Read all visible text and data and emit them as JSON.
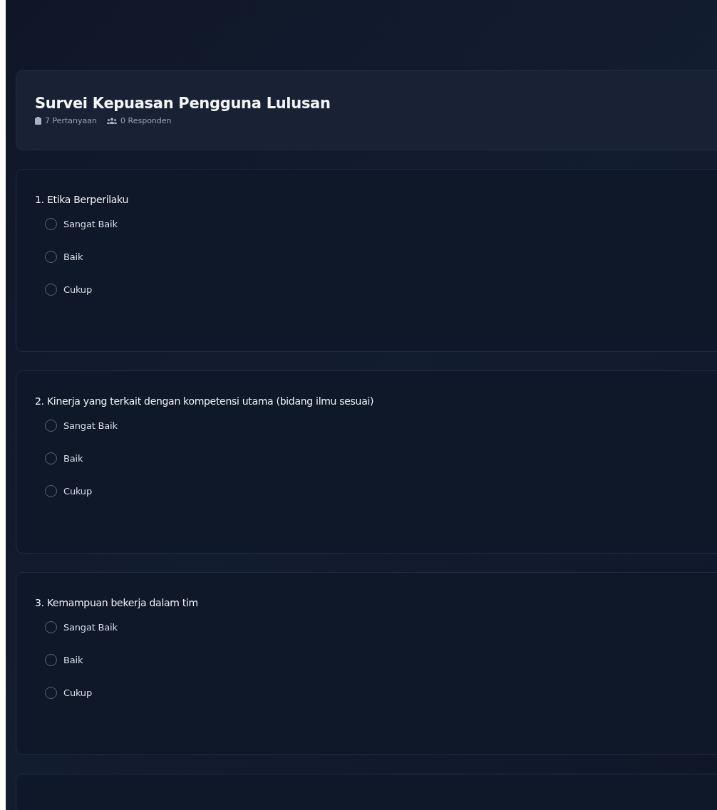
{
  "survey": {
    "title": "Survei Kepuasan Pengguna Lulusan",
    "questions_count": "7 Pertanyaan",
    "respondents_count": "0 Responden"
  },
  "questions": [
    {
      "kind": "question",
      "text": "1. Etika Berperilaku",
      "options": [
        {
          "label": "Sangat Baik",
          "selected": false
        },
        {
          "label": "Baik",
          "selected": false
        },
        {
          "label": "Cukup",
          "selected": false
        }
      ]
    },
    {
      "kind": "question",
      "text": "2. Kinerja yang terkait dengan kompetensi utama (bidang ilmu sesuai)",
      "options": [
        {
          "label": "Sangat Baik",
          "selected": false
        },
        {
          "label": "Baik",
          "selected": false
        },
        {
          "label": "Cukup",
          "selected": false
        }
      ]
    },
    {
      "kind": "question",
      "text": "3. Kemampuan bekerja dalam tim",
      "options": [
        {
          "label": "Sangat Baik",
          "selected": false
        },
        {
          "label": "Baik",
          "selected": false
        },
        {
          "label": "Cukup",
          "selected": false
        }
      ]
    },
    {
      "kind": "blank"
    }
  ]
}
